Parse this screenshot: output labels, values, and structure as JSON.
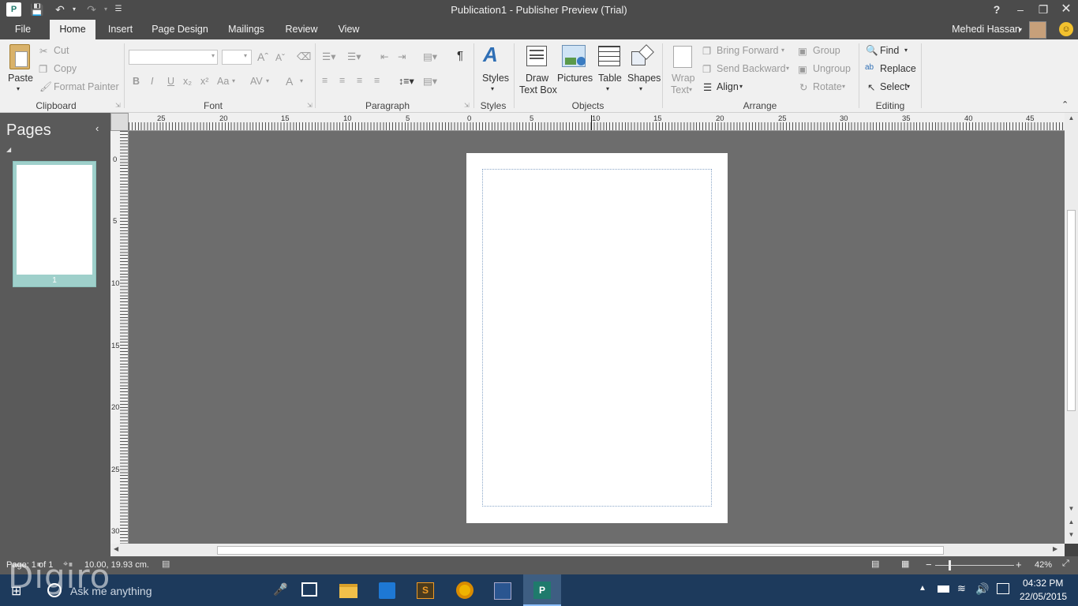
{
  "titlebar": {
    "title": "Publication1 - Publisher Preview (Trial)",
    "help": "?",
    "app_icon": "publisher-app-icon",
    "save_icon": "save-icon",
    "undo_icon": "undo-icon",
    "redo_icon": "redo-icon"
  },
  "menu": {
    "tabs": [
      "File",
      "Home",
      "Insert",
      "Page Design",
      "Mailings",
      "Review",
      "View"
    ],
    "active": "Home",
    "user": "Mehedi Hassan"
  },
  "ribbon": {
    "clipboard": {
      "paste": "Paste",
      "cut": "Cut",
      "copy": "Copy",
      "format_painter": "Format Painter",
      "label": "Clipboard"
    },
    "font": {
      "bold": "B",
      "italic": "I",
      "underline": "U",
      "subscript": "x₂",
      "superscript": "x²",
      "change_case": "Aa",
      "char_spacing": "AV",
      "font_color": "A",
      "label": "Font"
    },
    "paragraph": {
      "label": "Paragraph",
      "show_marks": "¶"
    },
    "styles": {
      "styles": "Styles",
      "label": "Styles"
    },
    "objects": {
      "draw_text_box_1": "Draw",
      "draw_text_box_2": "Text Box",
      "pictures": "Pictures",
      "table": "Table",
      "shapes": "Shapes",
      "label": "Objects"
    },
    "arrange": {
      "wrap_1": "Wrap",
      "wrap_2": "Text",
      "bring_forward": "Bring Forward",
      "send_backward": "Send Backward",
      "align": "Align",
      "group": "Group",
      "ungroup": "Ungroup",
      "rotate": "Rotate",
      "label": "Arrange"
    },
    "editing": {
      "find": "Find",
      "replace": "Replace",
      "select": "Select",
      "label": "Editing"
    }
  },
  "pages_panel": {
    "title": "Pages",
    "page_number": "1"
  },
  "ruler": {
    "h_ticks": [
      "25",
      "20",
      "15",
      "10",
      "5",
      "0",
      "5",
      "10",
      "15",
      "20",
      "25",
      "30",
      "35",
      "40",
      "45"
    ],
    "v_ticks": [
      "0",
      "5",
      "10",
      "15",
      "20",
      "25",
      "30"
    ]
  },
  "status": {
    "page": "Page: 1 of 1",
    "position": "10.00, 19.93 cm.",
    "zoom": "42%"
  },
  "taskbar": {
    "search_placeholder": "Ask me anything",
    "time": "04:32 PM",
    "date": "22/05/2015"
  },
  "watermark": "Digiro"
}
